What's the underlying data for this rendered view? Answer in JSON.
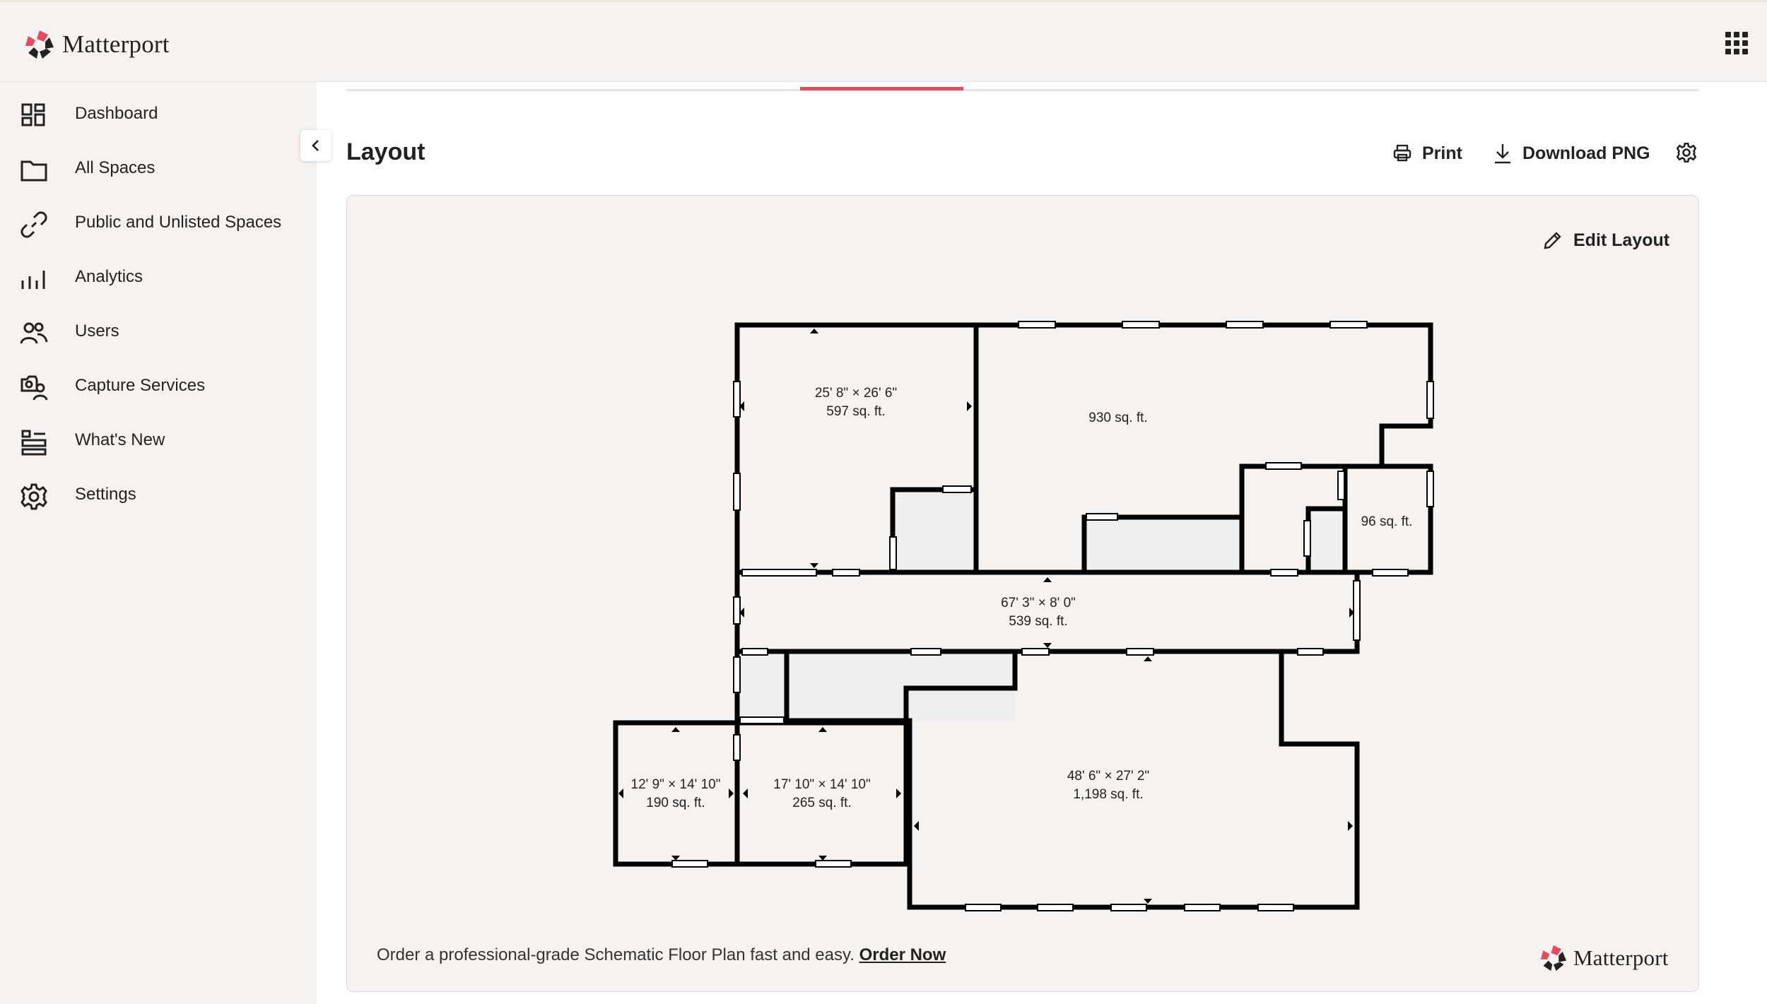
{
  "brand": {
    "name": "Matterport",
    "colors": {
      "red": "#e84a5f",
      "dark": "#222222"
    }
  },
  "header": {
    "apps_icon": "apps-grid-icon"
  },
  "sidebar": {
    "items": [
      {
        "label": "Dashboard",
        "icon": "dashboard-icon"
      },
      {
        "label": "All Spaces",
        "icon": "folder-icon"
      },
      {
        "label": "Public and Unlisted Spaces",
        "icon": "link-icon"
      },
      {
        "label": "Analytics",
        "icon": "analytics-icon"
      },
      {
        "label": "Users",
        "icon": "users-icon"
      },
      {
        "label": "Capture Services",
        "icon": "capture-services-icon"
      },
      {
        "label": "What's New",
        "icon": "whats-new-icon"
      },
      {
        "label": "Settings",
        "icon": "gear-icon"
      }
    ]
  },
  "main": {
    "title": "Layout",
    "print_label": "Print",
    "download_label": "Download PNG",
    "edit_label": "Edit Layout",
    "footer_text": "Order a professional-grade Schematic Floor Plan fast and easy.",
    "footer_link": "Order Now"
  },
  "floorplan": {
    "rooms": [
      {
        "dims": "25' 8\" × 26' 6\"",
        "area": "597 sq. ft."
      },
      {
        "dims": "",
        "area": "930 sq. ft."
      },
      {
        "dims": "",
        "area": "96 sq. ft."
      },
      {
        "dims": "67' 3\" × 8' 0\"",
        "area": "539 sq. ft."
      },
      {
        "dims": "12' 9\" × 14' 10\"",
        "area": "190 sq. ft."
      },
      {
        "dims": "17' 10\" × 14' 10\"",
        "area": "265 sq. ft."
      },
      {
        "dims": "48' 6\" × 27' 2\"",
        "area": "1,198 sq. ft."
      }
    ]
  }
}
